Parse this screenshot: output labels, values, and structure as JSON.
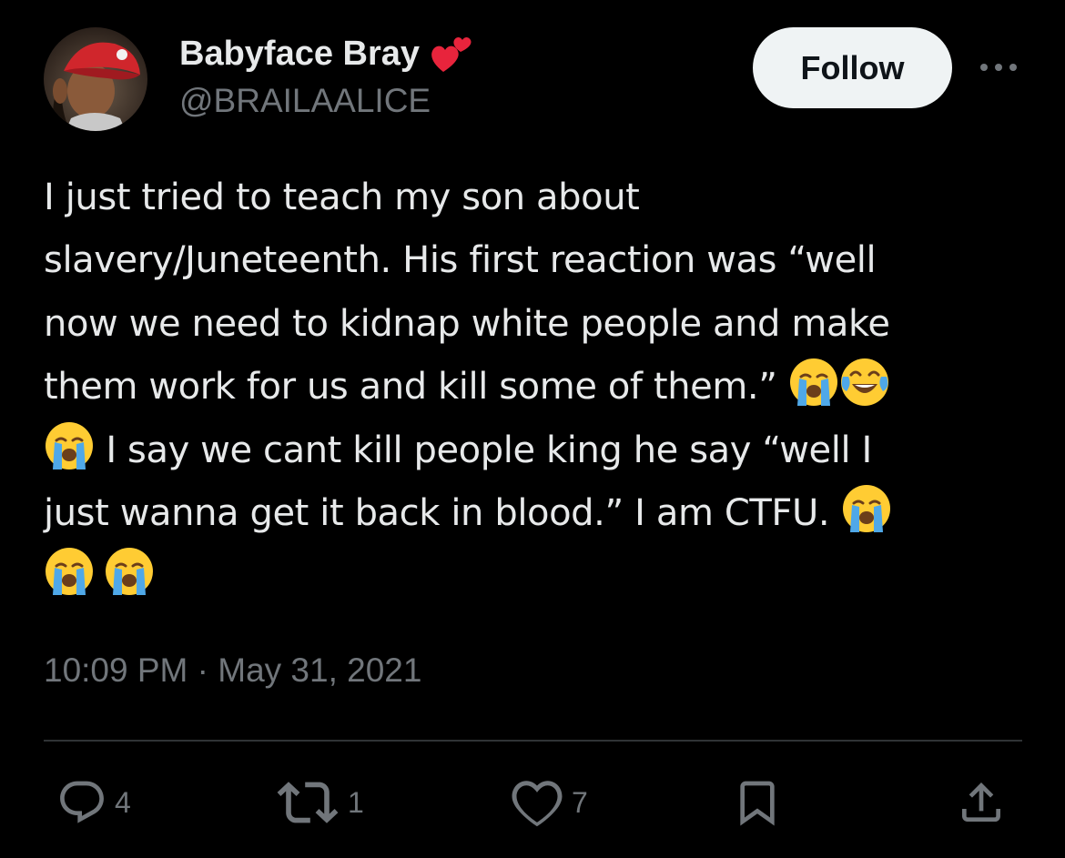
{
  "user": {
    "display_name": "Babyface Bray",
    "handle": "@BRAILAALICE",
    "badge_icon": "two-hearts-icon"
  },
  "header": {
    "follow_label": "Follow",
    "more_icon": "more-horizontal-icon"
  },
  "tweet": {
    "lines": [
      "I just tried to teach my son about",
      "slavery/Juneteenth. His first reaction was “well",
      "now we need to kidnap white people and make",
      "them work for us and kill some of them.”",
      " I say we cant kill people king he say “well I",
      "just wanna get it back in blood.” I am CTFU."
    ],
    "emojis": {
      "crying": "😭",
      "laughing": "😂"
    },
    "timestamp": "10:09 PM · May 31, 2021"
  },
  "actions": {
    "reply_count": "4",
    "retweet_count": "1",
    "like_count": "7"
  },
  "colors": {
    "background": "#000000",
    "text": "#e7e9ea",
    "secondary": "#71767b",
    "divider": "#2f3336",
    "follow_bg": "#eff3f4",
    "heart": "#f91880"
  }
}
